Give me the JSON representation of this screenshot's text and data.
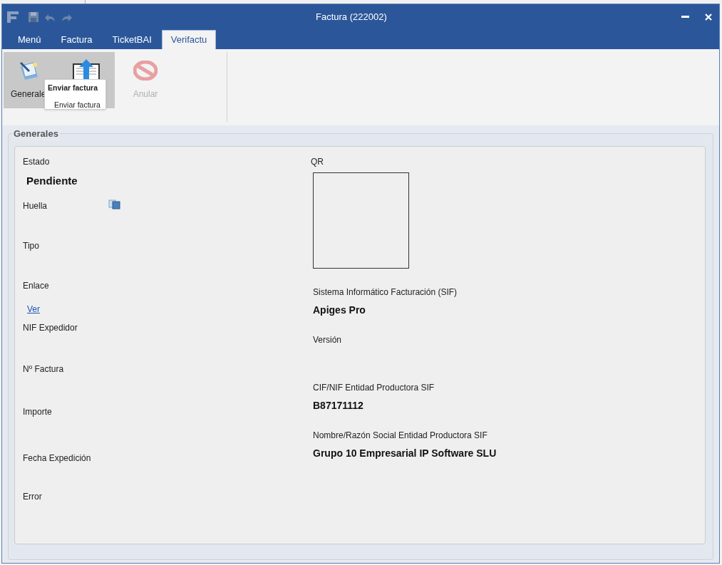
{
  "window": {
    "title": "Factura (222002)"
  },
  "tabs": [
    {
      "label": "Menú",
      "selected": false
    },
    {
      "label": "Factura",
      "selected": false
    },
    {
      "label": "TicketBAI",
      "selected": false
    },
    {
      "label": "Verifactu",
      "selected": true
    }
  ],
  "ribbon": {
    "buttons": [
      {
        "kind": "generales",
        "label": "Generale",
        "highlighted": true,
        "disabled": false
      },
      {
        "kind": "send",
        "highlighted": true,
        "disabled": false
      },
      {
        "kind": "cancel",
        "label": "Anular",
        "highlighted": false,
        "disabled": true
      }
    ],
    "tooltip": {
      "title": "Enviar factura",
      "text": "Enviar factura"
    }
  },
  "group": {
    "title": "Generales",
    "left_fields": [
      {
        "label": "Estado",
        "value": "Pendiente"
      },
      {
        "label": "Huella",
        "copy_icon": true
      },
      {
        "label": "Tipo"
      },
      {
        "label": "Enlace",
        "link": "Ver"
      },
      {
        "label": "NIF Expedidor"
      },
      {
        "label": "Nº Factura"
      },
      {
        "label": "Importe"
      },
      {
        "label": "Fecha Expedición"
      },
      {
        "label": "Error"
      }
    ],
    "qr": {
      "label": "QR"
    },
    "right_fields": [
      {
        "label": "Sistema Informático Facturación (SIF)",
        "value": "Apiges Pro"
      },
      {
        "label": "Versión"
      },
      {
        "label": "CIF/NIF Entidad Productora SIF",
        "value": "B87171112"
      },
      {
        "label": "Nombre/Razón Social Entidad Productora SIF",
        "value": "Grupo 10 Empresarial IP Software SLU"
      }
    ]
  }
}
